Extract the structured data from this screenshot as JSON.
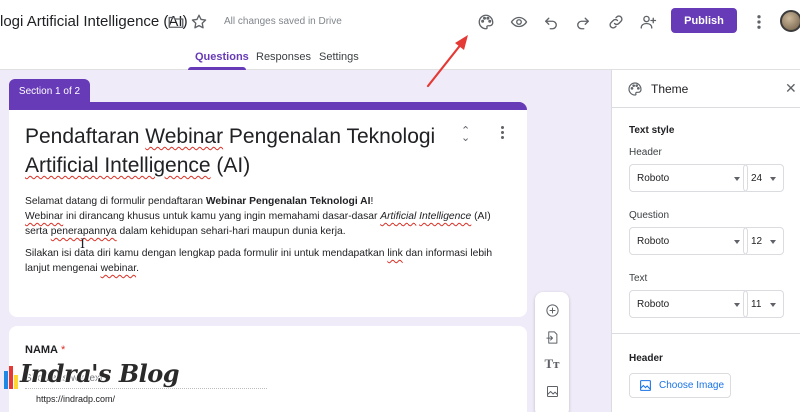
{
  "header": {
    "doc_title": "logi Artificial Intelligence (AI)",
    "save_status": "All changes saved in Drive",
    "publish_label": "Publish",
    "icons": [
      "folder-icon",
      "star-icon",
      "palette-icon",
      "preview-eye-icon",
      "undo-icon",
      "redo-icon",
      "link-icon",
      "add-collaborator-icon",
      "more-vert-icon"
    ]
  },
  "tabs": [
    {
      "label": "Questions",
      "active": true
    },
    {
      "label": "Responses",
      "active": false
    },
    {
      "label": "Settings",
      "active": false
    }
  ],
  "form": {
    "section_label": "Section 1 of 2",
    "title_parts": [
      "Pendaftaran ",
      "Webinar",
      " Pengenalan Teknologi ",
      "Artificial Intelligence",
      " (AI)"
    ],
    "desc_p1_a": "Selamat datang di formulir pendaftaran ",
    "desc_p1_b": "Webinar Pengenalan Teknologi AI",
    "desc_p1_c": "!",
    "desc_p2_a": "Webinar",
    "desc_p2_b": " ini dirancang khusus untuk kamu yang ingin memahami dasar-dasar ",
    "desc_p2_c": "Artificial",
    "desc_p2_d": " ",
    "desc_p2_e": "Intelligence",
    "desc_p2_f": " (AI) serta ",
    "desc_p2_g": "penerapannya",
    "desc_p2_h": " dalam kehidupan sehari-hari maupun dunia kerja.",
    "desc_p3_a": "Silakan isi data diri kamu dengan lengkap pada formulir ini untuk mendapatkan ",
    "desc_p3_b": "link",
    "desc_p3_c": " dan informasi lebih lanjut mengenai ",
    "desc_p3_d": "webinar",
    "desc_p3_e": ".",
    "question": {
      "label": "NAMA",
      "required_mark": "*",
      "placeholder": "Short answer text"
    }
  },
  "side_toolbar": [
    "add-question-icon",
    "import-questions-icon",
    "add-title-icon",
    "add-image-icon"
  ],
  "theme_panel": {
    "title": "Theme",
    "text_style_heading": "Text style",
    "rows": [
      {
        "label": "Header",
        "font": "Roboto",
        "size": "24"
      },
      {
        "label": "Question",
        "font": "Roboto",
        "size": "12"
      },
      {
        "label": "Text",
        "font": "Roboto",
        "size": "11"
      }
    ],
    "header_heading": "Header",
    "choose_image_label": "Choose Image"
  },
  "watermark": {
    "text": "Indra's Blog",
    "url": "https://indradp.com/"
  },
  "colors": {
    "accent": "#673ab7",
    "canvas_bg": "#f0ebf8",
    "annotation_arrow": "#e53935",
    "link_blue": "#1a73e8"
  }
}
